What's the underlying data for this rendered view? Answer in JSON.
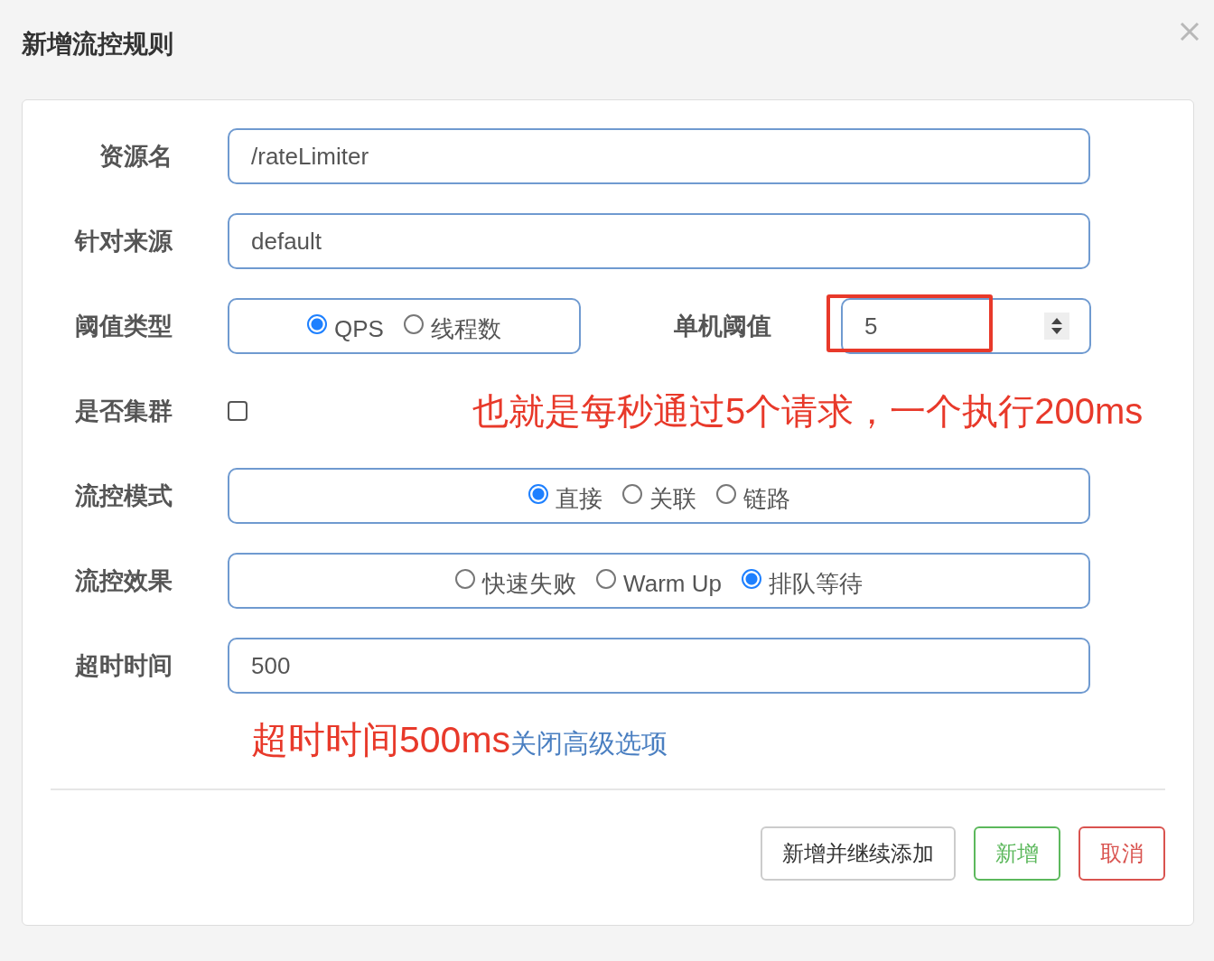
{
  "dialog": {
    "title": "新增流控规则"
  },
  "rows": [
    {
      "kind": "text",
      "label": "资源名",
      "value": "/rateLimiter"
    },
    {
      "kind": "text",
      "label": "针对来源",
      "value": "default"
    },
    {
      "kind": "split",
      "label": "阈值类型",
      "options": [
        {
          "label": "QPS",
          "selected": true
        },
        {
          "label": "线程数",
          "selected": false
        }
      ],
      "second_label": "单机阈值",
      "value": "5",
      "highlighted": true
    },
    {
      "kind": "checkbox",
      "label": "是否集群",
      "checked": false,
      "note": "也就是每秒通过5个请求，一个执行200ms"
    },
    {
      "kind": "radio",
      "label": "流控模式",
      "options": [
        {
          "label": "直接",
          "selected": true
        },
        {
          "label": "关联",
          "selected": false
        },
        {
          "label": "链路",
          "selected": false
        }
      ]
    },
    {
      "kind": "radio",
      "label": "流控效果",
      "options": [
        {
          "label": "快速失败",
          "selected": false
        },
        {
          "label": "Warm Up",
          "selected": false
        },
        {
          "label": "排队等待",
          "selected": true
        }
      ]
    },
    {
      "kind": "text",
      "label": "超时时间",
      "value": "500"
    }
  ],
  "note": {
    "text": "超时时间500ms",
    "link": "关闭高级选项"
  },
  "buttons": [
    {
      "label": "新增并继续添加",
      "kind": "default"
    },
    {
      "label": "新增",
      "kind": "success"
    },
    {
      "label": "取消",
      "kind": "danger"
    }
  ]
}
